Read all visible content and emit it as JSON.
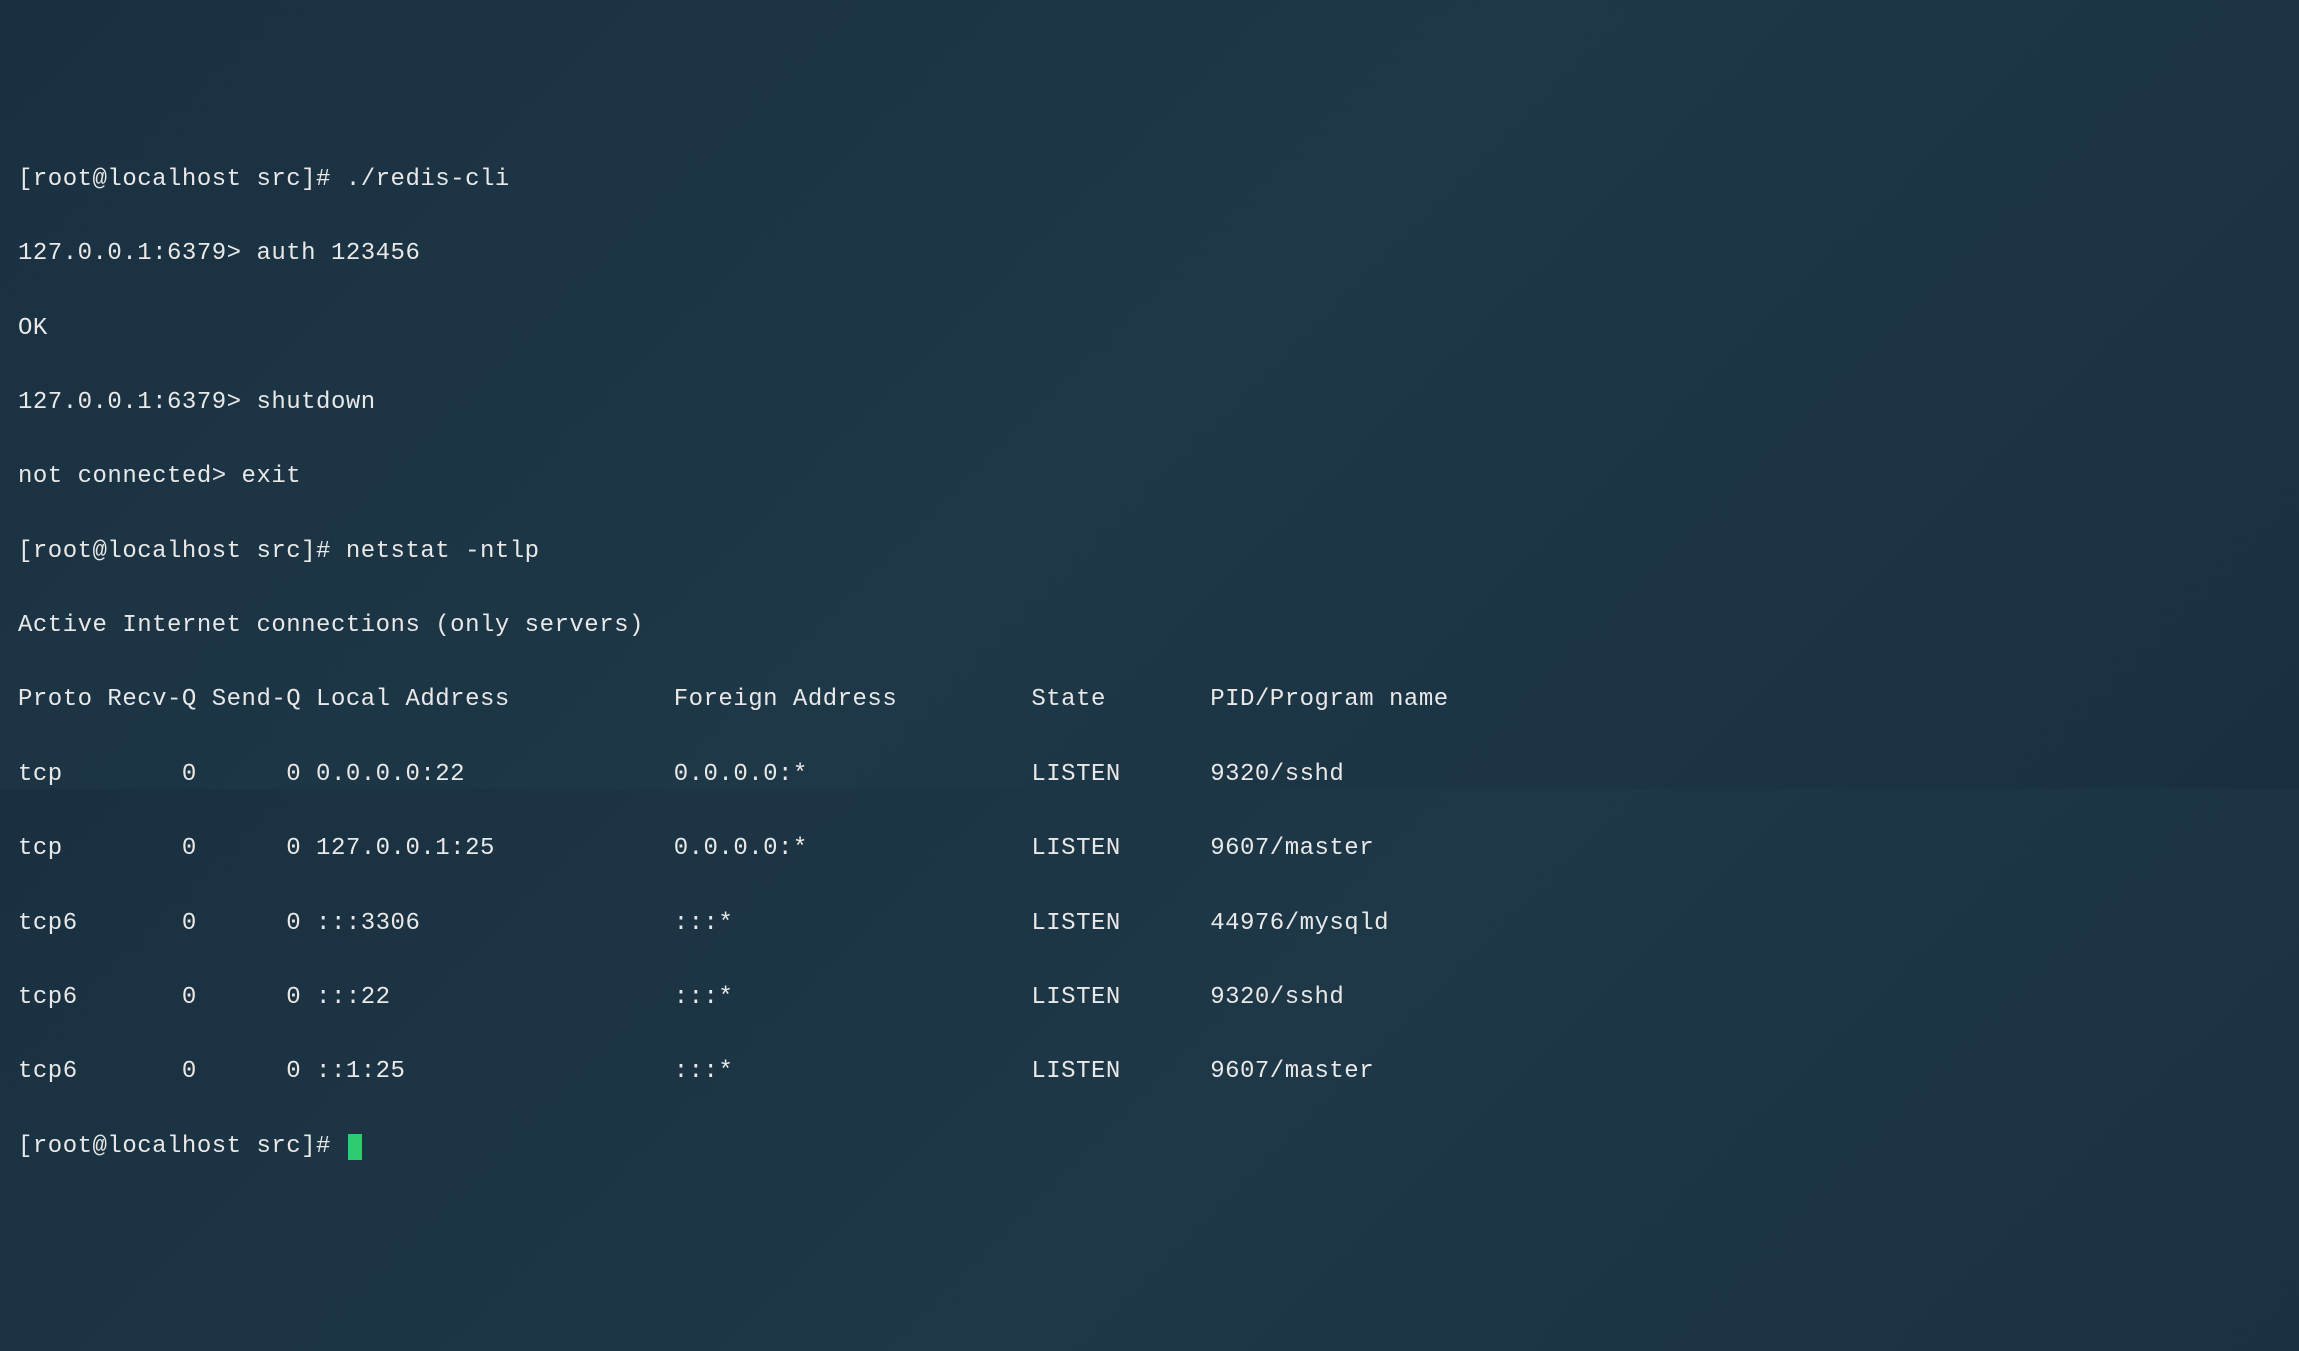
{
  "lines": {
    "l1": "[root@localhost src]# ./redis-cli",
    "l2": "127.0.0.1:6379> auth 123456",
    "l3": "OK",
    "l4": "127.0.0.1:6379> shutdown",
    "l5": "not connected> exit",
    "l6": "[root@localhost src]# netstat -ntlp",
    "l7": "Active Internet connections (only servers)",
    "l8": "Proto Recv-Q Send-Q Local Address           Foreign Address         State       PID/Program name    ",
    "l9": "tcp        0      0 0.0.0.0:22              0.0.0.0:*               LISTEN      9320/sshd           ",
    "l10": "tcp        0      0 127.0.0.1:25            0.0.0.0:*               LISTEN      9607/master         ",
    "l11": "tcp6       0      0 :::3306                 :::*                    LISTEN      44976/mysqld        ",
    "l12": "tcp6       0      0 :::22                   :::*                    LISTEN      9320/sshd           ",
    "l13": "tcp6       0      0 ::1:25                  :::*                    LISTEN      9607/master         ",
    "l14": "[root@localhost src]# "
  }
}
